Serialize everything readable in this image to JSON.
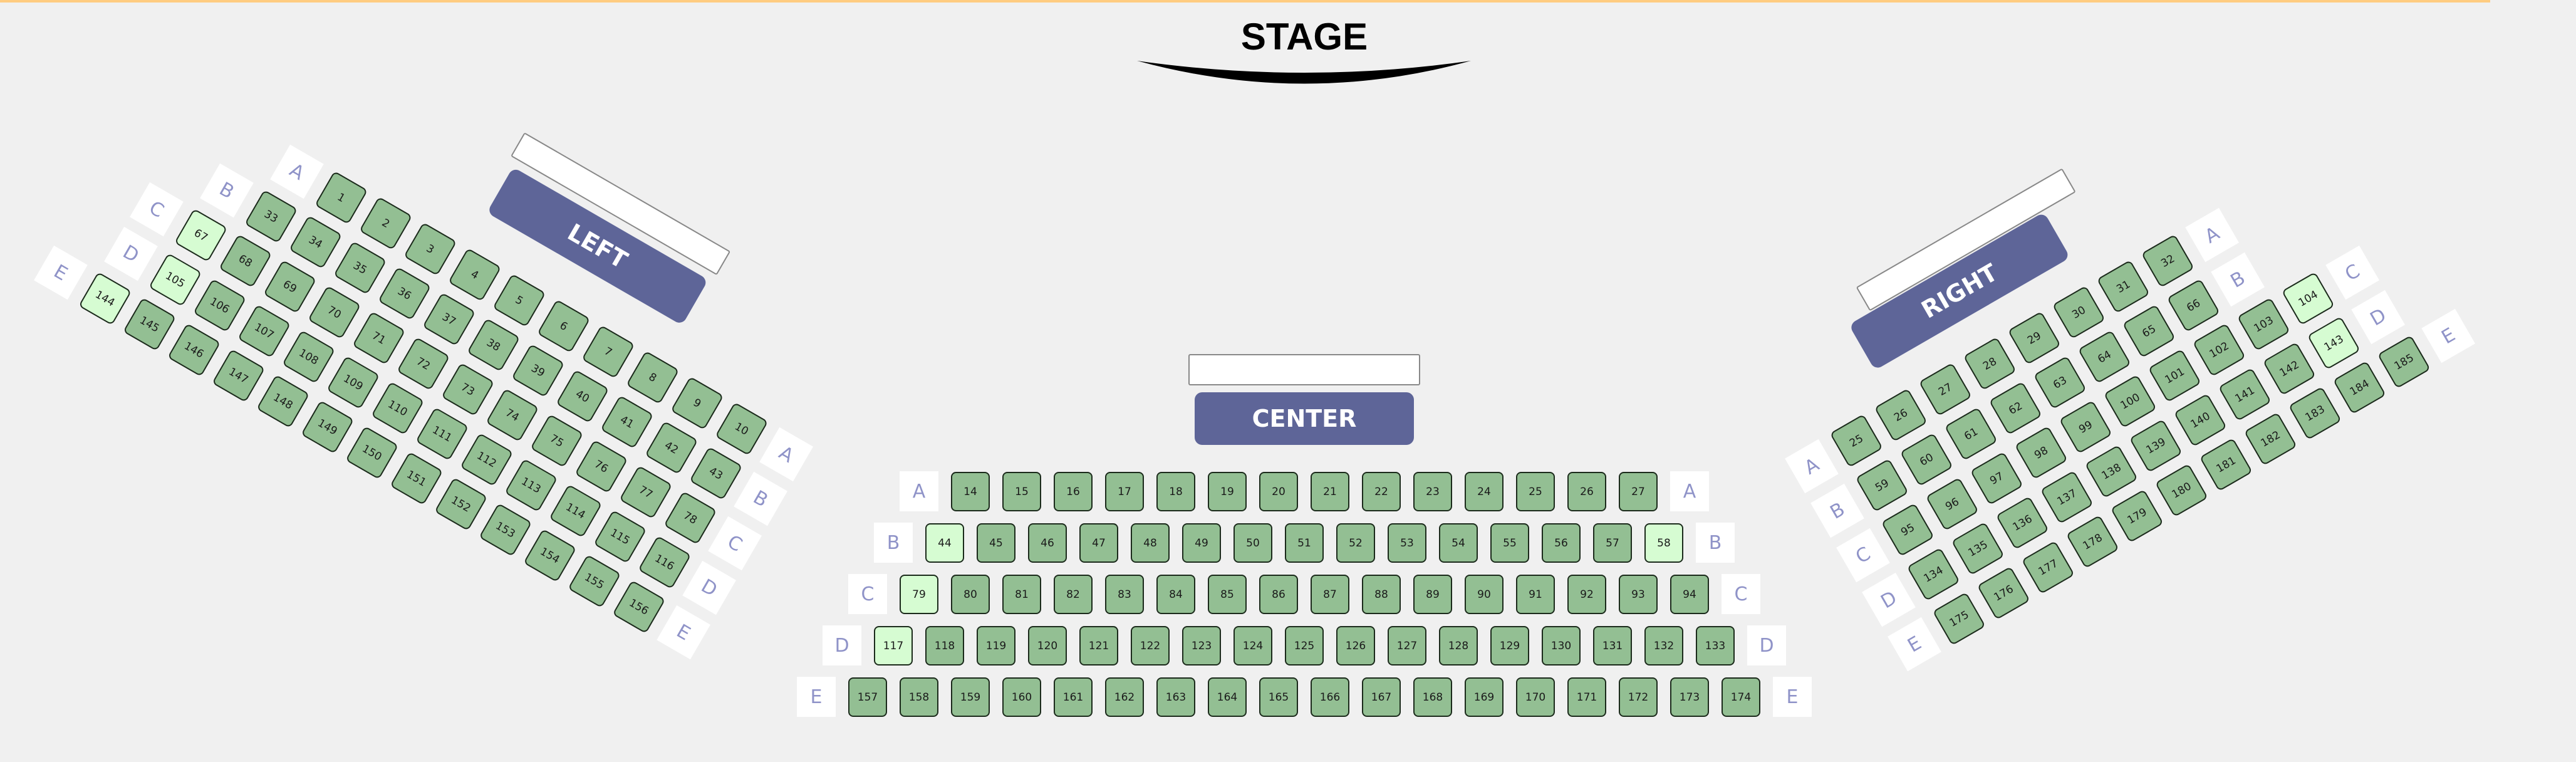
{
  "stage": {
    "title": "STAGE"
  },
  "colors": {
    "seat": "#93bf93",
    "seat_highlight": "#d6fcd2",
    "section_label_bg": "#5e6598",
    "row_label_text": "#8f93c8",
    "top_bar": "#ffcc80"
  },
  "sections": {
    "left": {
      "name": "LEFT",
      "rows": [
        {
          "label": "A",
          "seats": [
            "1",
            "2",
            "3",
            "4",
            "5",
            "6",
            "7",
            "8",
            "9",
            "10"
          ]
        },
        {
          "label": "B",
          "seats": [
            "33",
            "34",
            "35",
            "36",
            "37",
            "38",
            "39",
            "40",
            "41",
            "42",
            "43"
          ]
        },
        {
          "label": "C",
          "seats": [
            "67",
            "68",
            "69",
            "70",
            "71",
            "72",
            "73",
            "74",
            "75",
            "76",
            "77",
            "78"
          ]
        },
        {
          "label": "D",
          "seats": [
            "105",
            "106",
            "107",
            "108",
            "109",
            "110",
            "111",
            "112",
            "113",
            "114",
            "115",
            "116"
          ]
        },
        {
          "label": "E",
          "seats": [
            "144",
            "145",
            "146",
            "147",
            "148",
            "149",
            "150",
            "151",
            "152",
            "153",
            "154",
            "155",
            "156"
          ]
        }
      ],
      "highlighted": [
        "67",
        "105",
        "144"
      ]
    },
    "center": {
      "name": "CENTER",
      "rows": [
        {
          "label": "A",
          "seats": [
            "14",
            "15",
            "16",
            "17",
            "18",
            "19",
            "20",
            "21",
            "22",
            "23",
            "24",
            "25",
            "26",
            "27"
          ]
        },
        {
          "label": "B",
          "seats": [
            "44",
            "45",
            "46",
            "47",
            "48",
            "49",
            "50",
            "51",
            "52",
            "53",
            "54",
            "55",
            "56",
            "57",
            "58"
          ]
        },
        {
          "label": "C",
          "seats": [
            "79",
            "80",
            "81",
            "82",
            "83",
            "84",
            "85",
            "86",
            "87",
            "88",
            "89",
            "90",
            "91",
            "92",
            "93",
            "94"
          ]
        },
        {
          "label": "D",
          "seats": [
            "117",
            "118",
            "119",
            "120",
            "121",
            "122",
            "123",
            "124",
            "125",
            "126",
            "127",
            "128",
            "129",
            "130",
            "131",
            "132",
            "133"
          ]
        },
        {
          "label": "E",
          "seats": [
            "157",
            "158",
            "159",
            "160",
            "161",
            "162",
            "163",
            "164",
            "165",
            "166",
            "167",
            "168",
            "169",
            "170",
            "171",
            "172",
            "173",
            "174"
          ]
        }
      ],
      "highlighted": [
        "44",
        "58",
        "79",
        "117"
      ]
    },
    "right": {
      "name": "RIGHT",
      "rows": [
        {
          "label": "A",
          "seats": [
            "25",
            "26",
            "27",
            "28",
            "29",
            "30",
            "31",
            "32"
          ]
        },
        {
          "label": "B",
          "seats": [
            "59",
            "60",
            "61",
            "62",
            "63",
            "64",
            "65",
            "66"
          ]
        },
        {
          "label": "C",
          "seats": [
            "95",
            "96",
            "97",
            "98",
            "99",
            "100",
            "101",
            "102",
            "103",
            "104"
          ]
        },
        {
          "label": "D",
          "seats": [
            "134",
            "135",
            "136",
            "137",
            "138",
            "139",
            "140",
            "141",
            "142",
            "143"
          ]
        },
        {
          "label": "E",
          "seats": [
            "175",
            "176",
            "177",
            "178",
            "179",
            "180",
            "181",
            "182",
            "183",
            "184",
            "185"
          ]
        }
      ],
      "highlighted": [
        "104",
        "143"
      ]
    }
  }
}
